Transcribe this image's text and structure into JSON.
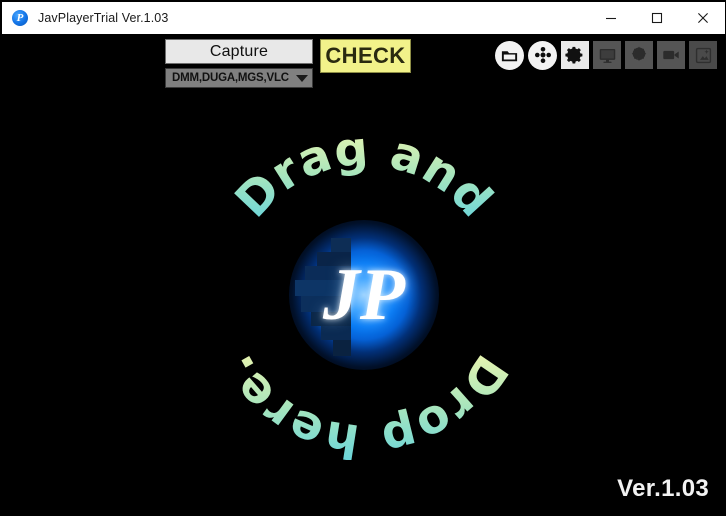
{
  "window": {
    "title": "JavPlayerTrial Ver.1.03",
    "app_icon": "jp-logo-icon",
    "controls": {
      "minimize": "minimize-icon",
      "maximize": "maximize-icon",
      "close": "close-icon"
    },
    "titlebar_bg": "#ffffff",
    "content_bg": "#000000"
  },
  "toolbar": {
    "capture_label": "Capture",
    "capture_source_value": "DMM,DUGA,MGS,VLC",
    "capture_source_options": [
      "DMM,DUGA,MGS,VLC"
    ],
    "check_label": "CHECK",
    "check_bg": "#f2f28a",
    "icons": [
      {
        "name": "folder-open-icon",
        "style": "round"
      },
      {
        "name": "film-reel-icon",
        "style": "round"
      },
      {
        "name": "gear-settings-icon",
        "style": "square-active"
      },
      {
        "name": "monitor-display-icon",
        "style": "square"
      },
      {
        "name": "brightness-contrast-icon",
        "style": "square"
      },
      {
        "name": "video-camera-icon",
        "style": "square"
      },
      {
        "name": "image-enhance-icon",
        "style": "square-dim"
      }
    ]
  },
  "drop_area": {
    "ring_text_top": "Drag and",
    "ring_text_bottom": "Drop here.",
    "full_message": "Drag and Drop here.",
    "logo_text": "JP",
    "text_gradient_start": "#f0f5a8",
    "text_gradient_end": "#6fd8e0",
    "glow_color": "#0a7cf5"
  },
  "status": {
    "version": "Ver.1.03"
  }
}
